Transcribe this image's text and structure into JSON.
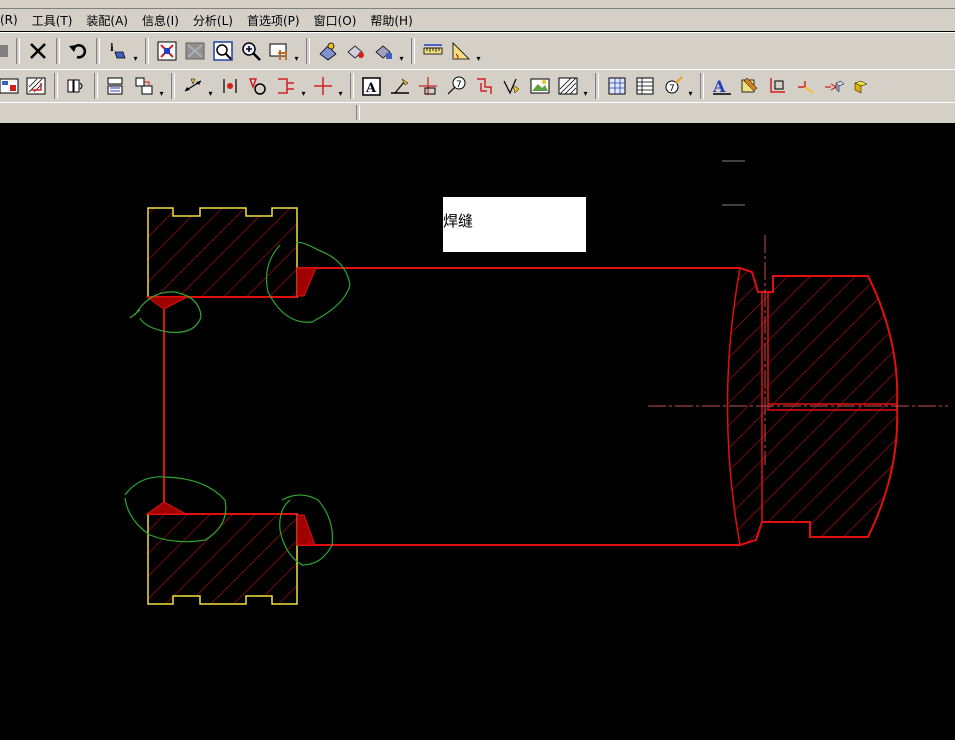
{
  "menubar": {
    "items": [
      {
        "label": "(R)"
      },
      {
        "label": "工具(T)"
      },
      {
        "label": "装配(A)"
      },
      {
        "label": "信息(I)"
      },
      {
        "label": "分析(L)"
      },
      {
        "label": "首选项(P)"
      },
      {
        "label": "窗口(O)"
      },
      {
        "label": "帮助(H)"
      }
    ]
  },
  "toolbar1": {
    "icons": [
      "partial-icon",
      "delete-icon",
      "undo-icon",
      "info-icon",
      "fit-icon",
      "shaded-icon",
      "zoom-window-icon",
      "zoom-icon",
      "pan-icon",
      "layer-icon",
      "view-icon",
      "display-icon",
      "measure-distance-icon",
      "measure-angle-icon"
    ]
  },
  "toolbar2": {
    "icons": [
      "drafting-view-icon",
      "section-view-icon",
      "detail-view-icon",
      "base-view-icon",
      "projected-view-icon",
      "dimension-icon",
      "ordinate-icon",
      "angular-icon",
      "hole-icon",
      "centerline-icon",
      "note-icon",
      "label-icon",
      "datum-icon",
      "balloon-icon",
      "weld-icon",
      "surface-finish-icon",
      "image-icon",
      "crosshatch-icon",
      "table-icon",
      "parts-list-icon",
      "id-symbol-icon",
      "text-style-icon",
      "edit-style-icon",
      "annotation-icon",
      "weld-symbol-icon",
      "model-icon",
      "object-icon"
    ]
  },
  "annotation": {
    "text": "焊缝"
  },
  "colors": {
    "part_outline": "#e01010",
    "yellow_part": "#f0e040",
    "weld_fill": "#a00000",
    "markup_circle": "#2fa52f",
    "centerline": "#c05050"
  }
}
